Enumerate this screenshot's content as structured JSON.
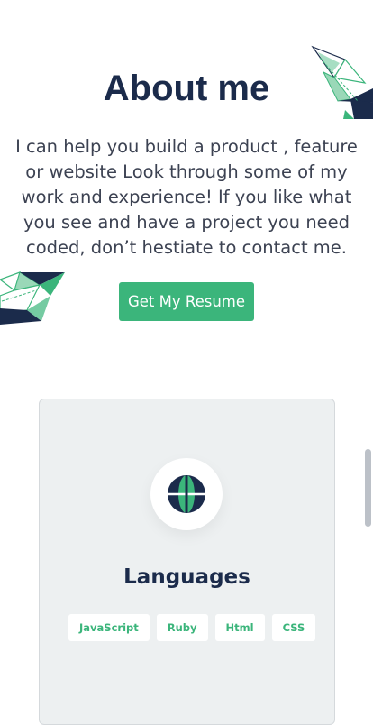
{
  "about": {
    "heading": "About me",
    "intro": "I can help you build a product , feature or website Look through some of my work and experience! If you like what you see and have a project you need coded, don’t hestiate to contact me.",
    "resume_button": "Get My Resume"
  },
  "languages_card": {
    "icon": "globe-icon",
    "title": "Languages",
    "tags": [
      "JavaScript",
      "Ruby",
      "Html",
      "CSS"
    ]
  },
  "colors": {
    "accent": "#3bb57b",
    "heading": "#1b2b4b",
    "text": "#3c4252",
    "card_bg": "#edf0f1"
  }
}
